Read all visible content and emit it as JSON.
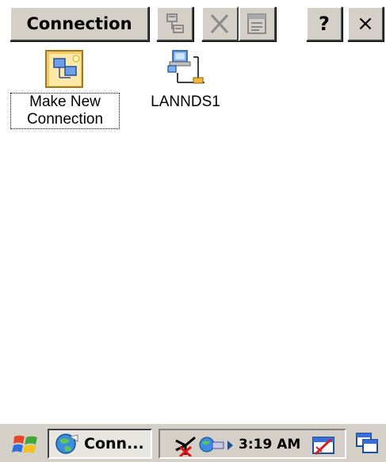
{
  "window": {
    "title": "Connection"
  },
  "toolbar": {
    "help_label": "?",
    "close_label": "×",
    "icons": [
      "network-properties-icon",
      "delete-icon",
      "properties-icon"
    ]
  },
  "items": [
    {
      "label_line1": "Make New",
      "label_line2": "Connection",
      "icon": "make-new-connection-icon"
    },
    {
      "label": "LANNDS1",
      "icon": "lan-connection-icon"
    }
  ],
  "taskbar": {
    "task_label": "Conn...",
    "clock": "3:19 AM",
    "icons": [
      "start-icon",
      "bluetooth-off-icon",
      "network-icon",
      "arrow-icon",
      "input-panel-icon",
      "desktop-icon"
    ]
  }
}
